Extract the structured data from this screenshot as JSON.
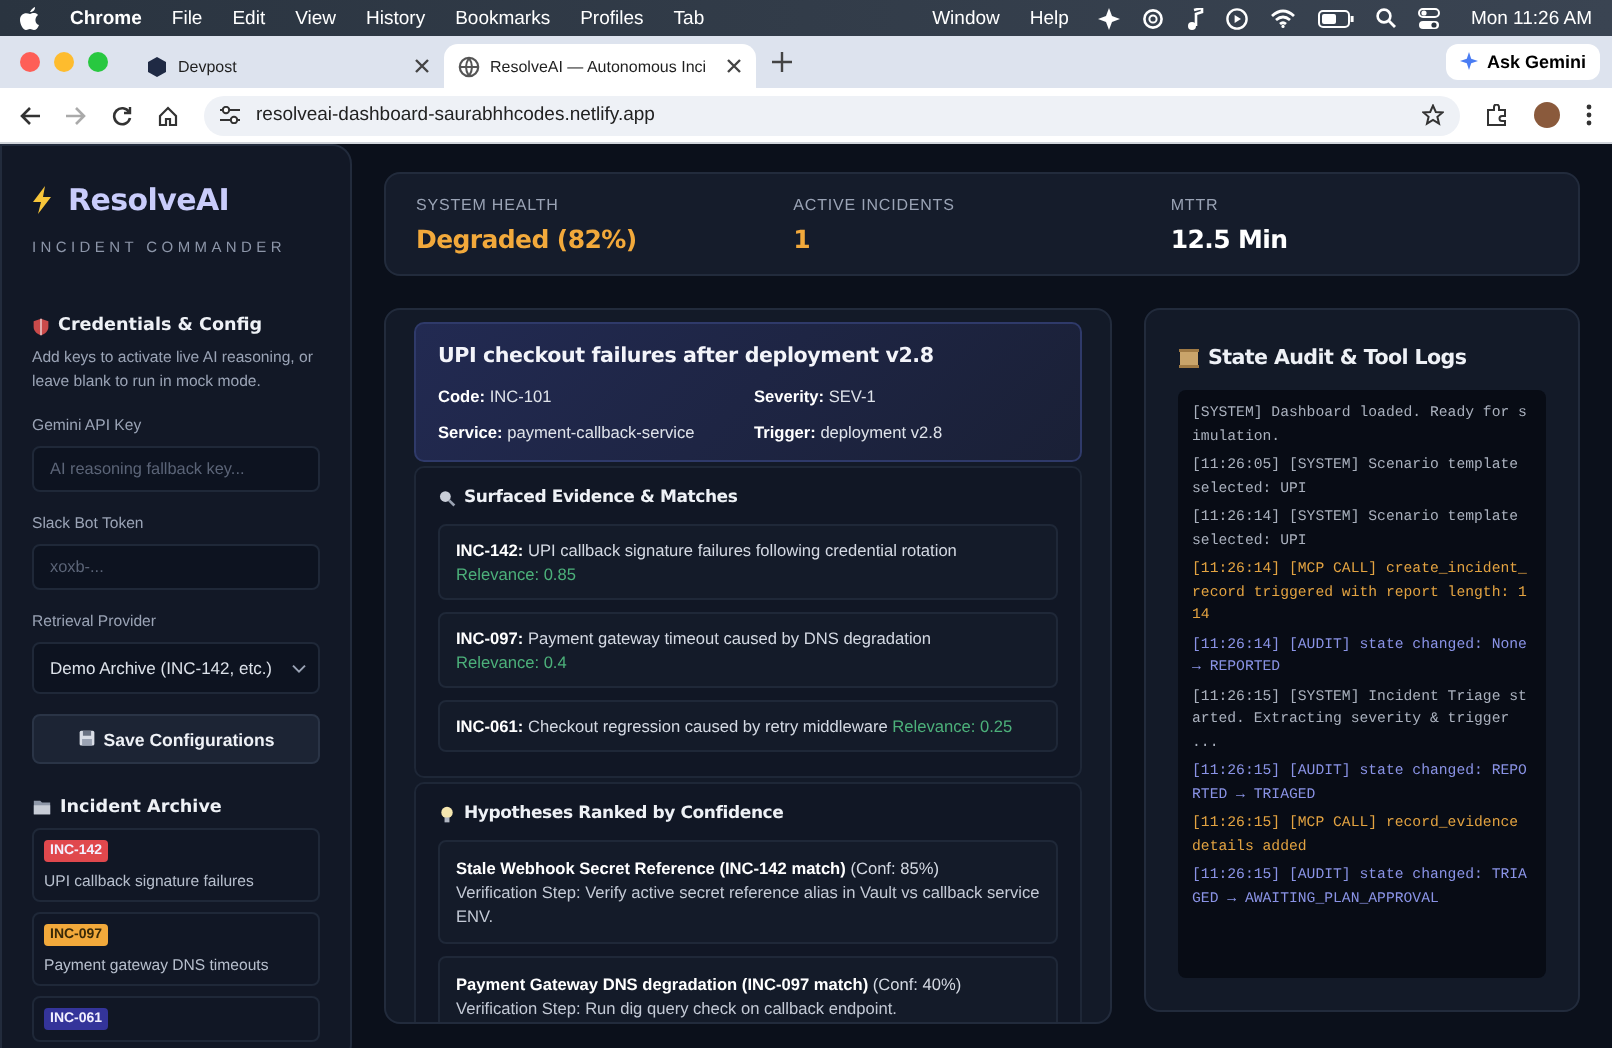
{
  "menubar": {
    "app": "Chrome",
    "menus": [
      "File",
      "Edit",
      "View",
      "History",
      "Bookmarks",
      "Profiles",
      "Tab"
    ],
    "right_menus": [
      "Window",
      "Help"
    ],
    "clock": "Mon 11:26 AM"
  },
  "browser": {
    "tabs": [
      {
        "title": "Devpost",
        "kind": "hexagon",
        "selected": false
      },
      {
        "title": "ResolveAI — Autonomous Inci",
        "kind": "globe",
        "selected": true
      }
    ],
    "ask_button": "Ask Gemini",
    "url": "resolveai-dashboard-saurabhhcodes.netlify.app"
  },
  "sidebar": {
    "brand": "ResolveAI",
    "tagline": "INCIDENT COMMANDER",
    "config_title": "Credentials & Config",
    "config_hint": "Add keys to activate live AI reasoning, or leave blank to run in mock mode.",
    "fields": [
      {
        "label": "Gemini API Key",
        "placeholder": "AI reasoning fallback key..."
      },
      {
        "label": "Slack Bot Token",
        "placeholder": "xoxb-..."
      }
    ],
    "provider": {
      "label": "Retrieval Provider",
      "value": "Demo Archive (INC-142, etc.)"
    },
    "save_button": "Save Configurations",
    "archive_title": "Incident Archive",
    "archive": [
      {
        "code": "INC-142",
        "title": "UPI callback signature failures",
        "color": "#e0484d"
      },
      {
        "code": "INC-097",
        "title": "Payment gateway DNS timeouts",
        "color": "#f2a93b"
      },
      {
        "code": "INC-061",
        "color": "#34349a"
      }
    ]
  },
  "metrics": [
    {
      "label": "SYSTEM HEALTH",
      "value": "Degraded (82%)",
      "color": "#f2a93b"
    },
    {
      "label": "ACTIVE INCIDENTS",
      "value": "1",
      "color": "#f2a93b"
    },
    {
      "label": "MTTR",
      "value": "12.5 Min",
      "color": "#ffffff"
    }
  ],
  "incident": {
    "title": "UPI checkout failures after deployment v2.8",
    "facts": [
      "**Code:** INC-101",
      "**Severity:** SEV-1",
      "**Service:** payment-callback-service",
      "**Trigger:** deployment v2.8"
    ],
    "evidence_title": "Surfaced Evidence & Matches",
    "evidence": [
      {
        "text": "**INC-142:** UPI callback signature failures following credential rotation",
        "relevance": "Relevance: 0.85"
      },
      {
        "text": "**INC-097:** Payment gateway timeout caused by DNS degradation",
        "relevance": "Relevance: 0.4"
      },
      {
        "text": "**INC-061:** Checkout regression caused by retry middleware",
        "relevance": "Relevance: 0.25"
      }
    ],
    "hypotheses_title": "Hypotheses Ranked by Confidence",
    "hypotheses": [
      {
        "title": "**Stale Webhook Secret Reference (INC-142 match)** (Conf: 85%)",
        "step": "Verification Step: Verify active secret reference alias in Vault vs callback service ENV."
      },
      {
        "title": "**Payment Gateway DNS degradation (INC-097 match)** (Conf: 40%)",
        "step": "Verification Step: Run dig query check on callback endpoint."
      }
    ]
  },
  "logs": {
    "title": "State Audit & Tool Logs",
    "entries": [
      {
        "kind": "system",
        "text": "[SYSTEM] Dashboard loaded. Ready for simulation."
      },
      {
        "kind": "system",
        "text": "[11:26:05] [SYSTEM] Scenario template selected: UPI"
      },
      {
        "kind": "system",
        "text": "[11:26:14] [SYSTEM] Scenario template selected: UPI"
      },
      {
        "kind": "mcp",
        "text": "[11:26:14] [MCP CALL] create_incident_record triggered with report length: 114"
      },
      {
        "kind": "audit",
        "text": "[11:26:14] [AUDIT] state changed: None → REPORTED"
      },
      {
        "kind": "system",
        "text": "[11:26:15] [SYSTEM] Incident Triage started. Extracting severity & trigger ..."
      },
      {
        "kind": "audit",
        "text": "[11:26:15] [AUDIT] state changed: REPORTED → TRIAGED"
      },
      {
        "kind": "mcp",
        "text": "[11:26:15] [MCP CALL] record_evidence details added"
      },
      {
        "kind": "audit",
        "text": "[11:26:15] [AUDIT] state changed: TRIAGED → AWAITING_PLAN_APPROVAL"
      }
    ]
  }
}
